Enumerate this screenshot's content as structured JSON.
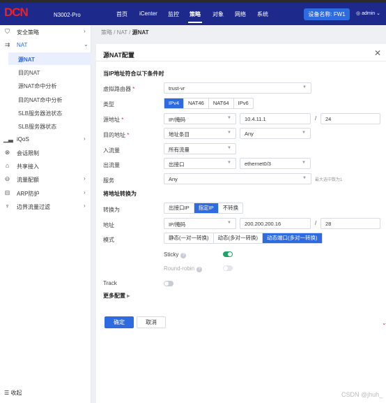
{
  "header": {
    "logo": "DCN",
    "product": "N3002-Pro",
    "nav": [
      "首页",
      "iCenter",
      "监控",
      "策略",
      "对象",
      "网络",
      "系统"
    ],
    "active_nav": "策略",
    "device_label": "设备名称: FW1",
    "user": "admin"
  },
  "sidebar": {
    "items": [
      {
        "label": "安全策略",
        "icon": "shield-icon"
      },
      {
        "label": "NAT",
        "icon": "nat-icon"
      },
      {
        "label": "iQoS",
        "icon": "bar-chart-icon"
      },
      {
        "label": "会话限制",
        "icon": "session-limit-icon"
      },
      {
        "label": "共享接入",
        "icon": "share-icon"
      },
      {
        "label": "流量配额",
        "icon": "quota-icon"
      },
      {
        "label": "ARP防护",
        "icon": "arp-icon"
      },
      {
        "label": "边界流量过滤",
        "icon": "filter-icon"
      }
    ],
    "nat_children": [
      "源NAT",
      "目的NAT",
      "源NAT命中分析",
      "目的NAT命中分析",
      "SLB服务器池状态",
      "SLB服务器状态"
    ],
    "collapse_label": "收起"
  },
  "breadcrumb": {
    "path": "策略 / NAT / ",
    "current": "源NAT"
  },
  "dialog": {
    "title": "源NAT配置",
    "section_match": "当IP地址符合以下条件时",
    "section_translate": "将地址转换为",
    "fields": {
      "vrouter_label": "虚拟路由器",
      "vrouter_value": "trust-vr",
      "type_label": "类型",
      "type_options": [
        "IPv4",
        "NAT46",
        "NAT64",
        "IPv6"
      ],
      "type_selected": "IPv4",
      "src_label": "源地址",
      "src_kind": "IP/掩码",
      "src_ip": "10.4.11.1",
      "src_mask": "24",
      "dst_label": "目的地址",
      "dst_kind": "地址条目",
      "dst_value": "Any",
      "ingress_label": "入流量",
      "ingress_value": "所有流量",
      "egress_label": "出流量",
      "egress_kind": "出接口",
      "egress_value": "ethernet0/3",
      "service_label": "服务",
      "service_value": "Any",
      "service_hint": "最大选中数为1",
      "convert_label": "转换为",
      "convert_options": [
        "出接口IP",
        "指定IP",
        "不转换"
      ],
      "convert_selected": "指定IP",
      "addr_label": "地址",
      "addr_kind": "IP/掩码",
      "addr_ip": "200.200.200.16",
      "addr_mask": "28",
      "mode_label": "模式",
      "mode_options": [
        "静态(一对一转换)",
        "动态(多对一转换)",
        "动态端口(多对一转换)"
      ],
      "mode_selected": "动态端口(多对一转换)",
      "sticky_label": "Sticky",
      "sticky_on": true,
      "roundrobin_label": "Round-robin",
      "roundrobin_on": false,
      "track_label": "Track",
      "track_on": false,
      "more_label": "更多配置"
    },
    "ok_label": "确定",
    "cancel_label": "取消"
  },
  "watermark": "CSDN @jhuh_",
  "colors": {
    "header": "#1d2a8c",
    "accent": "#2f6be0",
    "toggle_on": "#21a366",
    "toggle_off": "#c8ccd4"
  }
}
